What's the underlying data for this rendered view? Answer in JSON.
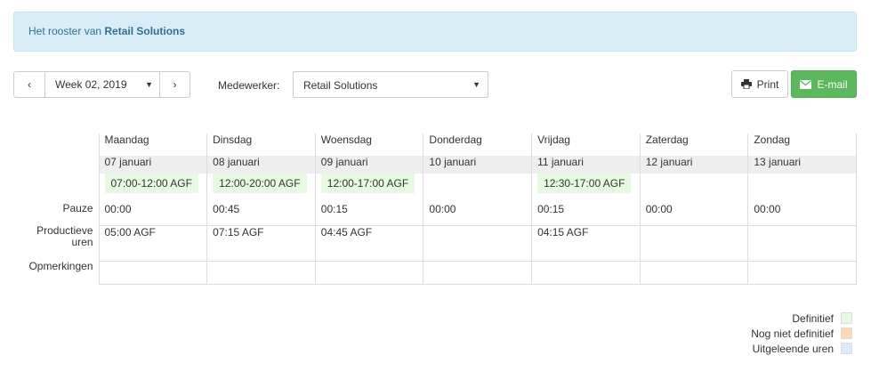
{
  "banner": {
    "prefix": "Het rooster van ",
    "company": "Retail Solutions"
  },
  "week_nav": {
    "prev_label": "‹",
    "next_label": "›",
    "week_value": "Week 02, 2019"
  },
  "employee": {
    "label": "Medewerker:",
    "value": "Retail Solutions"
  },
  "actions": {
    "print_label": "Print",
    "email_label": "E-mail"
  },
  "row_labels": {
    "pause": "Pauze",
    "productive": "Productieve uren",
    "remarks": "Opmerkingen"
  },
  "days": [
    {
      "name": "Maandag",
      "date": "07 januari",
      "shift": "07:00-12:00 AGF",
      "pause": "00:00",
      "productive": "05:00 AGF",
      "remarks": ""
    },
    {
      "name": "Dinsdag",
      "date": "08 januari",
      "shift": "12:00-20:00 AGF",
      "pause": "00:45",
      "productive": "07:15 AGF",
      "remarks": ""
    },
    {
      "name": "Woensdag",
      "date": "09 januari",
      "shift": "12:00-17:00 AGF",
      "pause": "00:15",
      "productive": "04:45 AGF",
      "remarks": ""
    },
    {
      "name": "Donderdag",
      "date": "10 januari",
      "shift": "",
      "pause": "00:00",
      "productive": "",
      "remarks": ""
    },
    {
      "name": "Vrijdag",
      "date": "11 januari",
      "shift": "12:30-17:00 AGF",
      "pause": "00:15",
      "productive": "04:15 AGF",
      "remarks": ""
    },
    {
      "name": "Zaterdag",
      "date": "12 januari",
      "shift": "",
      "pause": "00:00",
      "productive": "",
      "remarks": ""
    },
    {
      "name": "Zondag",
      "date": "13 januari",
      "shift": "",
      "pause": "00:00",
      "productive": "",
      "remarks": ""
    }
  ],
  "legend": [
    {
      "label": "Definitief",
      "color": "#e6f9e1"
    },
    {
      "label": "Nog niet definitief",
      "color": "#fcd9b2"
    },
    {
      "label": "Uitgeleende uren",
      "color": "#dbeaf5"
    }
  ]
}
